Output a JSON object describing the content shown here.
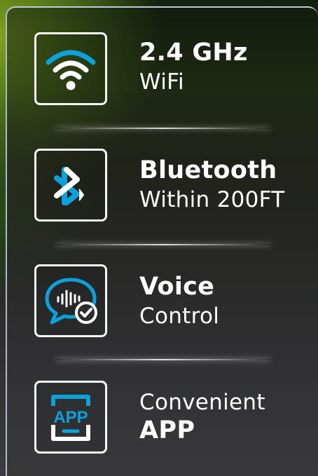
{
  "features": [
    {
      "title": "2.4 GHz",
      "subtitle": "WiFi",
      "icon": "wifi-icon"
    },
    {
      "title": "Bluetooth",
      "subtitle": "Within 200FT",
      "icon": "bluetooth-icon"
    },
    {
      "title": "Voice",
      "subtitle": "Control",
      "icon": "voice-control-icon"
    },
    {
      "title": "Convenient",
      "subtitle": "APP",
      "icon": "app-icon",
      "icon_text": "APP"
    }
  ],
  "colors": {
    "accent": "#0aa2dd",
    "text": "#ffffff",
    "border": "#f4f7f8"
  }
}
